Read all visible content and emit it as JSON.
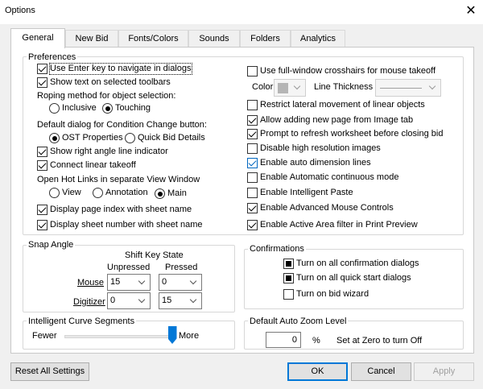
{
  "window": {
    "title": "Options"
  },
  "tabs": [
    "General",
    "New Bid",
    "Fonts/Colors",
    "Sounds",
    "Folders",
    "Analytics"
  ],
  "preferences": {
    "label": "Preferences",
    "use_enter_key": "Use Enter key to navigate in dialogs",
    "show_text_toolbars": "Show text on selected toolbars",
    "roping_label": "Roping method for object selection:",
    "roping_inclusive": "Inclusive",
    "roping_touching": "Touching",
    "default_dialog_label": "Default dialog for Condition Change button:",
    "ost_properties": "OST Properties",
    "quick_bid_details": "Quick Bid Details",
    "show_right_angle": "Show right angle line indicator",
    "connect_linear": "Connect linear takeoff",
    "hotlinks_label": "Open Hot Links in separate View Window",
    "hotlinks_view": "View",
    "hotlinks_annotation": "Annotation",
    "hotlinks_main": "Main",
    "display_page_index": "Display page index with sheet name",
    "display_sheet_number": "Display sheet number with sheet name",
    "use_crosshairs": "Use full-window crosshairs for mouse takeoff",
    "color_label": "Color",
    "line_thickness_label": "Line Thickness",
    "restrict_lateral": "Restrict lateral movement of linear objects",
    "allow_adding_page": "Allow adding new page from Image tab",
    "prompt_refresh": "Prompt to refresh worksheet before closing bid",
    "disable_high_res": "Disable high resolution images",
    "enable_auto_dimension": "Enable auto dimension lines",
    "enable_auto_continuous": "Enable Automatic continuous mode",
    "enable_intelligent_paste": "Enable Intelligent Paste",
    "enable_advanced_mouse": "Enable Advanced Mouse Controls",
    "enable_active_area": "Enable Active Area filter in Print Preview"
  },
  "snap_angle": {
    "label": "Snap Angle",
    "shift_key_state": "Shift Key State",
    "unpressed": "Unpressed",
    "pressed": "Pressed",
    "mouse_label": "Mouse",
    "digitizer_label": "Digitizer",
    "mouse_unpressed": "15",
    "mouse_pressed": "0",
    "digitizer_unpressed": "0",
    "digitizer_pressed": "15"
  },
  "intelligent_curve": {
    "label": "Intelligent Curve Segments",
    "fewer": "Fewer",
    "more": "More",
    "level": 1.0
  },
  "confirmations": {
    "label": "Confirmations",
    "all_confirmation": "Turn on all confirmation dialogs",
    "all_quick_start": "Turn on all quick start dialogs",
    "bid_wizard": "Turn on bid wizard"
  },
  "auto_zoom": {
    "label": "Default Auto Zoom Level",
    "value": "0",
    "unit": "%",
    "hint": "Set at Zero to turn Off"
  },
  "buttons": {
    "reset": "Reset All Settings",
    "ok": "OK",
    "cancel": "Cancel",
    "apply": "Apply"
  },
  "colors": {
    "accent": "#0078d7",
    "check_blue": "#0067c0"
  }
}
